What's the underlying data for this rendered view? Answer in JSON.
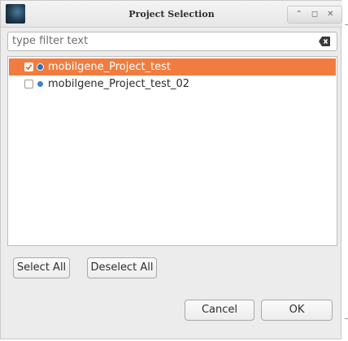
{
  "window": {
    "title": "Project Selection",
    "controls": [
      "⌃",
      "◻",
      "✕"
    ]
  },
  "filter": {
    "placeholder": "type filter text"
  },
  "projects": [
    {
      "name": "mobilgene_Project_test",
      "checked": true,
      "selected": true
    },
    {
      "name": "mobilgene_Project_test_02",
      "checked": false,
      "selected": false
    }
  ],
  "buttons": {
    "select_all": "Select All",
    "deselect_all": "Deselect All",
    "cancel": "Cancel",
    "ok": "OK"
  },
  "colors": {
    "selection": "#f07d3f",
    "project_icon": "#3d7fd0"
  },
  "icons": {
    "app": "app-logo-icon",
    "clear": "clear-text-icon",
    "project": "project-dot-icon"
  }
}
